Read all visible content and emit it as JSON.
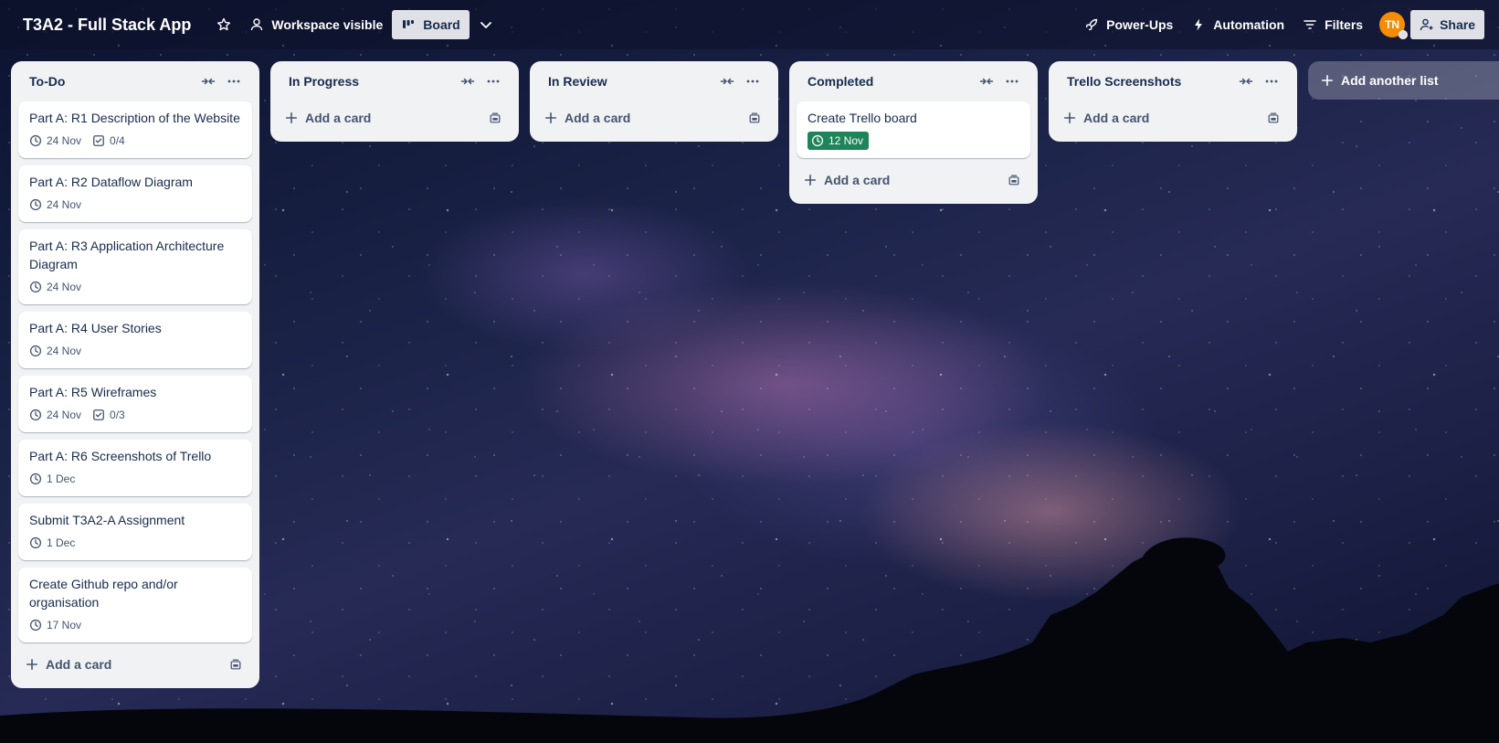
{
  "header": {
    "board_title": "T3A2 - Full Stack App",
    "visibility_label": "Workspace visible",
    "view_label": "Board",
    "powerups_label": "Power-Ups",
    "automation_label": "Automation",
    "filters_label": "Filters",
    "avatar_initials": "TN",
    "share_label": "Share"
  },
  "lists": [
    {
      "title": "To-Do",
      "cards": [
        {
          "title": "Part A: R1 Description of the Website",
          "due": "24 Nov",
          "checklist": "0/4"
        },
        {
          "title": "Part A: R2 Dataflow Diagram",
          "due": "24 Nov"
        },
        {
          "title": "Part A: R3 Application Architecture Diagram",
          "due": "24 Nov"
        },
        {
          "title": "Part A: R4 User Stories",
          "due": "24 Nov"
        },
        {
          "title": "Part A: R5 Wireframes",
          "due": "24 Nov",
          "checklist": "0/3"
        },
        {
          "title": "Part A: R6 Screenshots of Trello",
          "due": "1 Dec"
        },
        {
          "title": "Submit T3A2-A Assignment",
          "due": "1 Dec"
        },
        {
          "title": "Create Github repo and/or organisation",
          "due": "17 Nov"
        }
      ],
      "add_card_label": "Add a card"
    },
    {
      "title": "In Progress",
      "cards": [],
      "add_card_label": "Add a card"
    },
    {
      "title": "In Review",
      "cards": [],
      "add_card_label": "Add a card"
    },
    {
      "title": "Completed",
      "cards": [
        {
          "title": "Create Trello board",
          "due": "12 Nov",
          "due_complete": true
        }
      ],
      "add_card_label": "Add a card"
    },
    {
      "title": "Trello Screenshots",
      "cards": [],
      "add_card_label": "Add a card"
    }
  ],
  "add_list_label": "Add another list",
  "colors": {
    "list_bg": "#f1f2f4",
    "due_complete": "#1f845a",
    "avatar": "#f48c06",
    "text": "#172b4d"
  }
}
